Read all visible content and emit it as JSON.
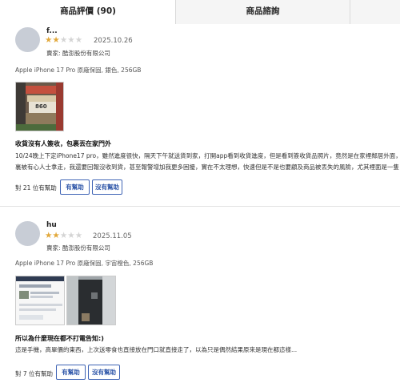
{
  "tabs": [
    {
      "label": "商品評價 (90)"
    },
    {
      "label": "商品諮詢"
    }
  ],
  "reviews": [
    {
      "username": "f...",
      "rating": 2,
      "rating_stars": "★★☆☆☆",
      "date": "2025.10.26",
      "seller": "賣家: 酷澎股份有限公司",
      "product": "Apple iPhone 17 Pro 原廠保固, 銀色, 256GB",
      "headline": "收貨沒有人簽收，包裹丟在家門外",
      "body_lines": [
        "10/24晚上下定iPhone17 pro，雖然進度很快，隔天下午就送貨到家，打開app看到收貨進度，但是看到簽收貨品照片，竟然是在家裡鄰居外面，",
        "裏被有心人士拿走，我還要回報沒收到貨，甚至報警增加我更多困擾，實在不太理想，快速但是不是也要顧及商品被丟失的風險，尤其裡面是一隻"
      ],
      "helpful_count": "對 21 位有幫助",
      "helpful_label": "有幫助",
      "unhelpful_label": "沒有幫助",
      "photo_label": "860"
    },
    {
      "username": "hu",
      "rating": 2,
      "rating_stars": "★★☆☆☆",
      "date": "2025.11.05",
      "seller": "賣家: 酷澎股份有限公司",
      "product": "Apple iPhone 17 Pro 原廠保固, 宇宙橙色, 256GB",
      "headline": "所以為什麼現在都不打電告知:)",
      "body_lines": [
        "這是手機，高單價的東西，上次送零食也直接放在門口就直接走了，以為只是偶然結果原來是現在都這樣..."
      ],
      "helpful_count": "對 7 位有幫助",
      "helpful_label": "有幫助",
      "unhelpful_label": "沒有幫助"
    }
  ],
  "colors": {
    "star": "#e2a83a",
    "star_off": "#d4d4d4",
    "button_border": "#3f64b5",
    "button_text": "#2d55a8",
    "avatar": "#c8cdd6"
  }
}
